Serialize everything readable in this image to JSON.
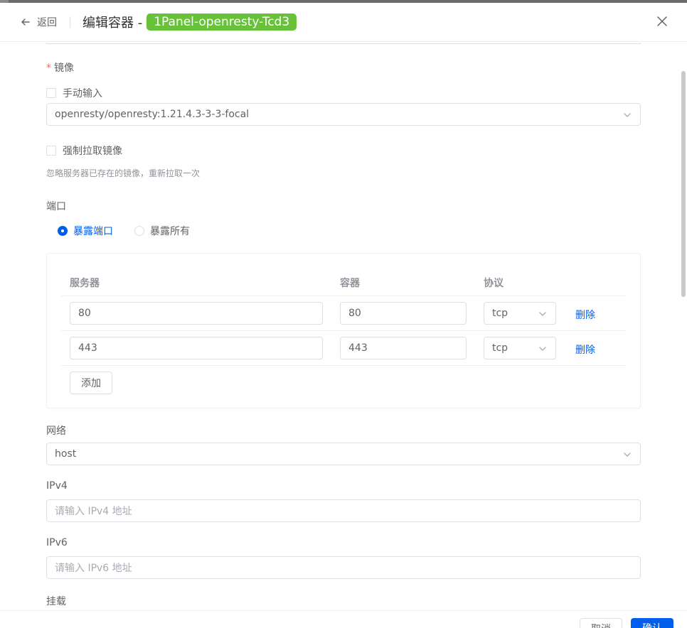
{
  "header": {
    "back_label": "返回",
    "title": "编辑容器 -",
    "container_name": "1Panel-openresty-Tcd3"
  },
  "form": {
    "image": {
      "label": "镜像",
      "manual_input_label": "手动输入",
      "selected_value": "openresty/openresty:1.21.4.3-3-3-focal"
    },
    "force_pull": {
      "label": "强制拉取镜像",
      "hint": "忽略服务器已存在的镜像，重新拉取一次"
    },
    "ports": {
      "label": "端口",
      "options": [
        "暴露端口",
        "暴露所有"
      ],
      "selected": "暴露端口",
      "columns": [
        "服务器",
        "容器",
        "协议"
      ],
      "rows": [
        {
          "server": "80",
          "container": "80",
          "protocol": "tcp",
          "action": "删除"
        },
        {
          "server": "443",
          "container": "443",
          "protocol": "tcp",
          "action": "删除"
        }
      ],
      "add_label": "添加"
    },
    "network": {
      "label": "网络",
      "selected_value": "host"
    },
    "ipv4": {
      "label": "IPv4",
      "placeholder": "请输入 IPv4 地址"
    },
    "ipv6": {
      "label": "IPv6",
      "placeholder": "请输入 IPv6 地址"
    },
    "mount": {
      "label": "挂载"
    }
  },
  "footer": {
    "cancel_label": "取消",
    "confirm_label": "确认"
  },
  "colors": {
    "primary": "#005eeb",
    "tag": "#67c23a",
    "required": "#f56c6c"
  }
}
